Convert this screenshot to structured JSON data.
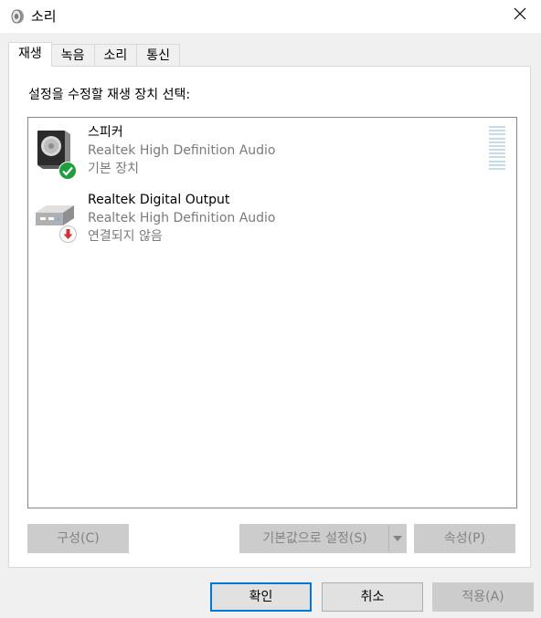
{
  "window": {
    "title": "소리",
    "icon": "speaker-icon"
  },
  "tabs": [
    {
      "label": "재생",
      "active": true
    },
    {
      "label": "녹음",
      "active": false
    },
    {
      "label": "소리",
      "active": false
    },
    {
      "label": "통신",
      "active": false
    }
  ],
  "playback": {
    "caption": "설정을 수정할 재생 장치 선택:",
    "devices": [
      {
        "name": "스피커",
        "driver": "Realtek High Definition Audio",
        "status": "기본 장치",
        "icon": "speaker-device-icon",
        "badge": "check-icon"
      },
      {
        "name": "Realtek Digital Output",
        "driver": "Realtek High Definition Audio",
        "status": "연결되지 않음",
        "icon": "digital-output-device-icon",
        "badge": "down-arrow-icon"
      }
    ],
    "buttons": {
      "configure": "구성(C)",
      "set_default": "기본값으로 설정(S)",
      "properties": "속성(P)"
    }
  },
  "footer": {
    "ok": "확인",
    "cancel": "취소",
    "apply": "적용(A)"
  },
  "colors": {
    "accent": "#0078d7",
    "check_badge": "#1e9e3e",
    "disconnected_badge": "#d13438",
    "disabled_button": "#cccccc"
  }
}
